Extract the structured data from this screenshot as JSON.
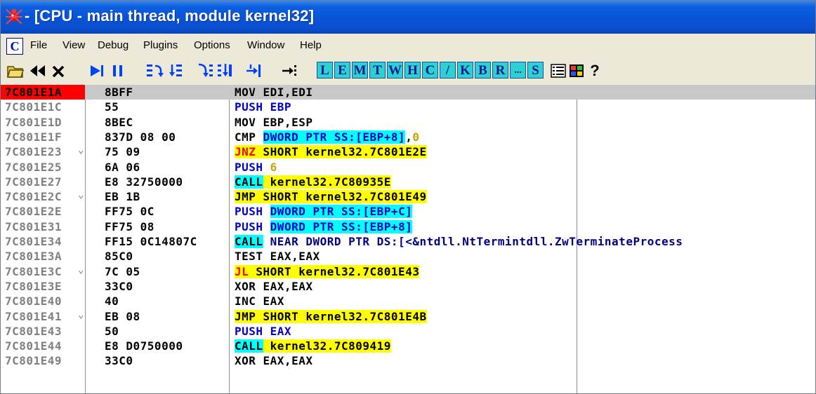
{
  "window": {
    "title": " - [CPU - main thread, module kernel32]"
  },
  "menu": {
    "c_icon": "C",
    "items": [
      "File",
      "View",
      "Debug",
      "Plugins",
      "Options",
      "Window",
      "Help"
    ]
  },
  "toolbar": {
    "icons": [
      "open-icon",
      "restart-icon",
      "close-icon",
      "run-icon",
      "pause-icon",
      "step-into-icon",
      "step-over-icon",
      "trace-into-icon",
      "trace-over-icon",
      "execute-till-return-icon",
      "goto-icon"
    ],
    "letter_buttons": [
      "L",
      "E",
      "M",
      "T",
      "W",
      "H",
      "C",
      "/",
      "K",
      "B",
      "R",
      "...",
      "S"
    ],
    "extra_icons": [
      "list-icon",
      "color-grid-icon",
      "help-icon"
    ],
    "help_label": "?"
  },
  "code": {
    "rows": [
      {
        "addr": "7C801E1A",
        "mark": "",
        "hex": "8BFF",
        "asm": [
          {
            "t": "MOV EDI,EDI",
            "c": "normal"
          }
        ]
      },
      {
        "addr": "7C801E1C",
        "mark": "",
        "hex": "55",
        "asm": [
          {
            "t": "PUSH EBP",
            "c": "blue"
          }
        ]
      },
      {
        "addr": "7C801E1D",
        "mark": "",
        "hex": "8BEC",
        "asm": [
          {
            "t": "MOV EBP,ESP",
            "c": "normal"
          }
        ]
      },
      {
        "addr": "7C801E1F",
        "mark": "",
        "hex": "837D 08 00",
        "asm": [
          {
            "t": "CMP ",
            "c": "normal"
          },
          {
            "t": "DWORD PTR SS:[EBP+8]",
            "c": "cyan"
          },
          {
            "t": ",",
            "c": "normal"
          },
          {
            "t": "0",
            "c": "gold"
          }
        ]
      },
      {
        "addr": "7C801E23",
        "mark": "⌄",
        "hex": "75 09",
        "asm": [
          {
            "t": "JNZ",
            "c": "red"
          },
          {
            "t": " SHORT kernel32.7C801E2E",
            "c": "hl-yellow"
          }
        ]
      },
      {
        "addr": "7C801E25",
        "mark": "",
        "hex": "6A 06",
        "asm": [
          {
            "t": "PUSH ",
            "c": "blue"
          },
          {
            "t": "6",
            "c": "gold"
          }
        ]
      },
      {
        "addr": "7C801E27",
        "mark": "",
        "hex": "E8 32750000",
        "asm": [
          {
            "t": "CALL",
            "c": "cyan-black"
          },
          {
            "t": " kernel32.7C80935E",
            "c": "hl-yellow"
          }
        ]
      },
      {
        "addr": "7C801E2C",
        "mark": "⌄",
        "hex": "EB 1B",
        "asm": [
          {
            "t": "JMP SHORT kernel32.7C801E49",
            "c": "hl-yellow"
          }
        ]
      },
      {
        "addr": "7C801E2E",
        "mark": "",
        "hex": "FF75 0C",
        "asm": [
          {
            "t": "PUSH ",
            "c": "blue"
          },
          {
            "t": "DWORD PTR SS:[EBP+C]",
            "c": "cyan"
          }
        ]
      },
      {
        "addr": "7C801E31",
        "mark": "",
        "hex": "FF75 08",
        "asm": [
          {
            "t": "PUSH ",
            "c": "blue"
          },
          {
            "t": "DWORD PTR SS:[EBP+8]",
            "c": "cyan"
          }
        ]
      },
      {
        "addr": "7C801E34",
        "mark": "",
        "hex": "FF15 0C14807C",
        "asm": [
          {
            "t": "CALL",
            "c": "cyan-black"
          },
          {
            "t": " NEAR DWORD PTR DS:[<&ntdll.NtTermi",
            "c": "navy"
          },
          {
            "t": "ntdll.ZwTerminateProcess",
            "c": "navy"
          }
        ]
      },
      {
        "addr": "7C801E3A",
        "mark": "",
        "hex": "85C0",
        "asm": [
          {
            "t": "TEST EAX,EAX",
            "c": "normal"
          }
        ]
      },
      {
        "addr": "7C801E3C",
        "mark": "⌄",
        "hex": "7C 05",
        "asm": [
          {
            "t": "JL",
            "c": "red"
          },
          {
            "t": " SHORT kernel32.7C801E43",
            "c": "hl-yellow"
          }
        ]
      },
      {
        "addr": "7C801E3E",
        "mark": "",
        "hex": "33C0",
        "asm": [
          {
            "t": "XOR EAX,EAX",
            "c": "normal"
          }
        ]
      },
      {
        "addr": "7C801E40",
        "mark": "",
        "hex": "40",
        "asm": [
          {
            "t": "INC EAX",
            "c": "normal"
          }
        ]
      },
      {
        "addr": "7C801E41",
        "mark": "⌄",
        "hex": "EB 08",
        "asm": [
          {
            "t": "JMP SHORT kernel32.7C801E4B",
            "c": "hl-yellow"
          }
        ]
      },
      {
        "addr": "7C801E43",
        "mark": "",
        "hex": "50",
        "asm": [
          {
            "t": "PUSH EAX",
            "c": "blue"
          }
        ]
      },
      {
        "addr": "7C801E44",
        "mark": "",
        "hex": "E8 D0750000",
        "asm": [
          {
            "t": "CALL",
            "c": "cyan-black"
          },
          {
            "t": " kernel32.7C809419",
            "c": "hl-yellow"
          }
        ]
      },
      {
        "addr": "7C801E49",
        "mark": "",
        "hex": "33C0",
        "asm": [
          {
            "t": "XOR EAX,EAX",
            "c": "normal"
          }
        ]
      }
    ]
  }
}
